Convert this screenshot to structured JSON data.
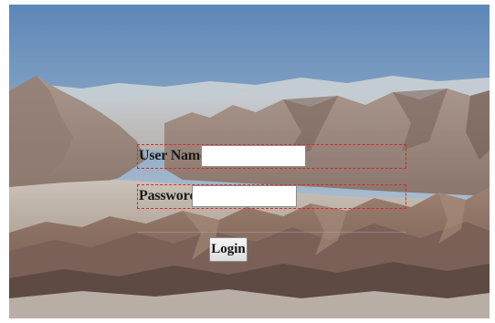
{
  "login_form": {
    "username_label": "User Name",
    "username_value": "",
    "password_label": "Password",
    "password_value": "",
    "login_button_label": "Login"
  },
  "colors": {
    "dashed_border": "#d42a2a",
    "sky_top": "#5d87b9",
    "sky_bottom": "#c9d3dc",
    "mountain_light": "#b59e8e",
    "mountain_dark": "#5e4a42"
  }
}
